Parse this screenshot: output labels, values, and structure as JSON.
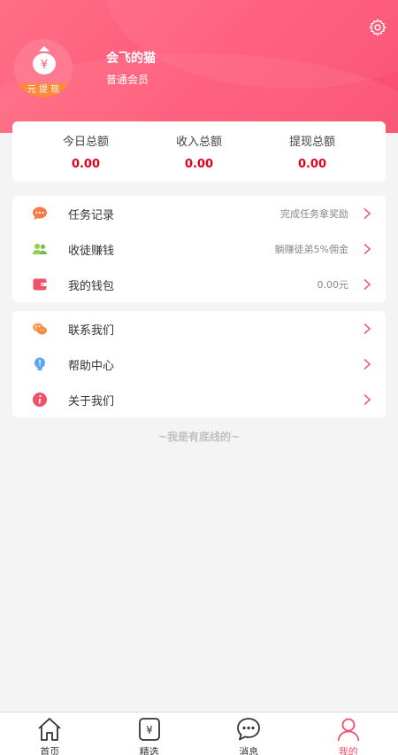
{
  "header": {
    "username": "会飞的猫",
    "member_level": "普通会员",
    "avatar_caption": "元 提 现"
  },
  "stats": [
    {
      "label": "今日总额",
      "value": "0.00"
    },
    {
      "label": "收入总额",
      "value": "0.00"
    },
    {
      "label": "提现总额",
      "value": "0.00"
    }
  ],
  "menu_group1": [
    {
      "label": "任务记录",
      "right": "完成任务拿奖励",
      "icon": "chat-bubble-icon"
    },
    {
      "label": "收徒赚钱",
      "right": "躺赚徒弟5%佣金",
      "icon": "users-icon"
    },
    {
      "label": "我的钱包",
      "right": "0.00元",
      "icon": "wallet-icon"
    }
  ],
  "menu_group2": [
    {
      "label": "联系我们",
      "icon": "wechat-icon"
    },
    {
      "label": "帮助中心",
      "icon": "bulb-icon"
    },
    {
      "label": "关于我们",
      "icon": "info-icon"
    }
  ],
  "footer_note": "~我是有底线的~",
  "tabs": [
    {
      "label": "首页",
      "icon": "home-icon"
    },
    {
      "label": "精选",
      "icon": "yuan-icon"
    },
    {
      "label": "消息",
      "icon": "message-icon"
    },
    {
      "label": "我的",
      "icon": "user-icon",
      "active": true
    }
  ],
  "colors": {
    "accent": "#f34d6b",
    "value_red": "#e2001a"
  }
}
